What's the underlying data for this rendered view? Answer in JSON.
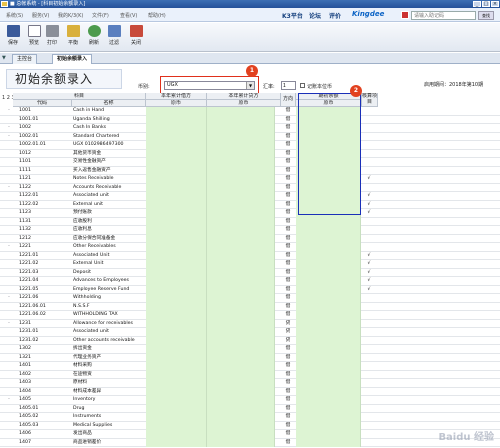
{
  "window": {
    "title": "■  总帐系统 - [科目初始余额录入]",
    "controls": [
      "_",
      "□",
      "×"
    ]
  },
  "menu": {
    "items": [
      "系统(S)",
      "服务(V)",
      "我的K/3(K)",
      "文件(F)",
      "查看(V)",
      "帮助(H)"
    ],
    "links": [
      "K3平台",
      "论坛",
      "评价"
    ],
    "brand": "Kingdee",
    "search_placeholder": "请输入助记码",
    "search_go": "查找"
  },
  "toolbar": {
    "buttons": [
      {
        "label": "保存",
        "icon": "save-icon"
      },
      {
        "label": "预览",
        "icon": "preview-icon"
      },
      {
        "label": "打印",
        "icon": "print-icon"
      },
      {
        "label": "平衡",
        "icon": "balance-icon"
      },
      {
        "label": "刷新",
        "icon": "refresh-icon"
      },
      {
        "label": "过滤",
        "icon": "filter-icon"
      },
      {
        "label": "关闭",
        "icon": "close-icon"
      }
    ]
  },
  "tabs": {
    "nav": "▼",
    "items": [
      "主控台",
      "初始余额录入"
    ],
    "active": 1
  },
  "header": {
    "title": "初始余额录入",
    "currency_label": "币别:",
    "currency_value": "UGX",
    "rate_label": "汇率:",
    "rate_value": "1",
    "base_currency_label": "记账本位币",
    "enable_period": "启用期间：2018年第10期"
  },
  "annotations": {
    "badge1": "1",
    "badge2": "2"
  },
  "grid": {
    "levels": "1 2 3",
    "headers": {
      "subject": "科目",
      "code": "代码",
      "name": "名称",
      "ytd_debit": "本年累计借方",
      "ytd_debit_orig": "原币",
      "ytd_credit": "本年累计贷方",
      "ytd_credit_orig": "原币",
      "direction": "方向",
      "opening": "期初余额",
      "opening_orig": "原币",
      "aux": "核算项目"
    },
    "rows": [
      {
        "code": "1001",
        "name": "Cash in Hand",
        "dir": "借",
        "flag": "",
        "exp": "-"
      },
      {
        "code": "1001.01",
        "name": "Uganda Shilling",
        "dir": "借",
        "flag": "",
        "exp": ""
      },
      {
        "code": "1002",
        "name": "Cash In Banks",
        "dir": "借",
        "flag": "",
        "exp": "-"
      },
      {
        "code": "1002.01",
        "name": "Standard Chartered",
        "dir": "借",
        "flag": "",
        "exp": "-"
      },
      {
        "code": "1002.01.01",
        "name": "UGX 0102986497300",
        "dir": "借",
        "flag": "",
        "exp": ""
      },
      {
        "code": "1012",
        "name": "其他货币资金",
        "dir": "借",
        "flag": "",
        "exp": ""
      },
      {
        "code": "1101",
        "name": "交易性金融资产",
        "dir": "借",
        "flag": "",
        "exp": ""
      },
      {
        "code": "1111",
        "name": "买入返售金融资产",
        "dir": "借",
        "flag": "",
        "exp": ""
      },
      {
        "code": "1121",
        "name": "Notes Receivable",
        "dir": "借",
        "flag": "√",
        "exp": ""
      },
      {
        "code": "1122",
        "name": "Accounts Receivable",
        "dir": "借",
        "flag": "",
        "exp": "-"
      },
      {
        "code": "1122.01",
        "name": "Associated unit",
        "dir": "借",
        "flag": "√",
        "exp": ""
      },
      {
        "code": "1122.02",
        "name": "External unit",
        "dir": "借",
        "flag": "√",
        "exp": ""
      },
      {
        "code": "1123",
        "name": "预付账款",
        "dir": "借",
        "flag": "√",
        "exp": ""
      },
      {
        "code": "1131",
        "name": "应收股利",
        "dir": "借",
        "flag": "",
        "exp": ""
      },
      {
        "code": "1132",
        "name": "应收利息",
        "dir": "借",
        "flag": "",
        "exp": ""
      },
      {
        "code": "1212",
        "name": "应收分保合同准备金",
        "dir": "借",
        "flag": "",
        "exp": ""
      },
      {
        "code": "1221",
        "name": "Other Receivables",
        "dir": "借",
        "flag": "",
        "exp": "-"
      },
      {
        "code": "1221.01",
        "name": "Associated Unit",
        "dir": "借",
        "flag": "√",
        "exp": ""
      },
      {
        "code": "1221.02",
        "name": "External Unit",
        "dir": "借",
        "flag": "√",
        "exp": ""
      },
      {
        "code": "1221.03",
        "name": "Deposit",
        "dir": "借",
        "flag": "√",
        "exp": ""
      },
      {
        "code": "1221.04",
        "name": "Advances to Employees",
        "dir": "借",
        "flag": "√",
        "exp": ""
      },
      {
        "code": "1221.05",
        "name": "Employee Reserve Fund",
        "dir": "借",
        "flag": "√",
        "exp": ""
      },
      {
        "code": "1221.06",
        "name": "Withholding",
        "dir": "借",
        "flag": "",
        "exp": "-"
      },
      {
        "code": "1221.06.01",
        "name": "N.S.S.F",
        "dir": "借",
        "flag": "",
        "exp": ""
      },
      {
        "code": "1221.06.02",
        "name": "WITHHOLDING TAX",
        "dir": "借",
        "flag": "",
        "exp": ""
      },
      {
        "code": "1231",
        "name": "Allowance for receivables",
        "dir": "贷",
        "flag": "",
        "exp": "-"
      },
      {
        "code": "1231.01",
        "name": "Associated unit",
        "dir": "贷",
        "flag": "",
        "exp": ""
      },
      {
        "code": "1231.02",
        "name": "Other accounts receivable",
        "dir": "贷",
        "flag": "",
        "exp": ""
      },
      {
        "code": "1302",
        "name": "拆出资金",
        "dir": "借",
        "flag": "",
        "exp": ""
      },
      {
        "code": "1321",
        "name": "代理业务资产",
        "dir": "借",
        "flag": "",
        "exp": ""
      },
      {
        "code": "1401",
        "name": "材料采购",
        "dir": "借",
        "flag": "",
        "exp": ""
      },
      {
        "code": "1402",
        "name": "在途物资",
        "dir": "借",
        "flag": "",
        "exp": ""
      },
      {
        "code": "1403",
        "name": "原材料",
        "dir": "借",
        "flag": "",
        "exp": ""
      },
      {
        "code": "1404",
        "name": "材料成本差异",
        "dir": "借",
        "flag": "",
        "exp": ""
      },
      {
        "code": "1405",
        "name": "Inventory",
        "dir": "借",
        "flag": "",
        "exp": "-"
      },
      {
        "code": "1405.01",
        "name": "Drug",
        "dir": "借",
        "flag": "",
        "exp": ""
      },
      {
        "code": "1405.02",
        "name": "Instruments",
        "dir": "借",
        "flag": "",
        "exp": ""
      },
      {
        "code": "1405.03",
        "name": "Medical Supplies",
        "dir": "借",
        "flag": "",
        "exp": ""
      },
      {
        "code": "1406",
        "name": "发出商品",
        "dir": "借",
        "flag": "",
        "exp": ""
      },
      {
        "code": "1407",
        "name": "商品进销差价",
        "dir": "借",
        "flag": "",
        "exp": ""
      }
    ]
  },
  "watermark": "Baidu 经验"
}
